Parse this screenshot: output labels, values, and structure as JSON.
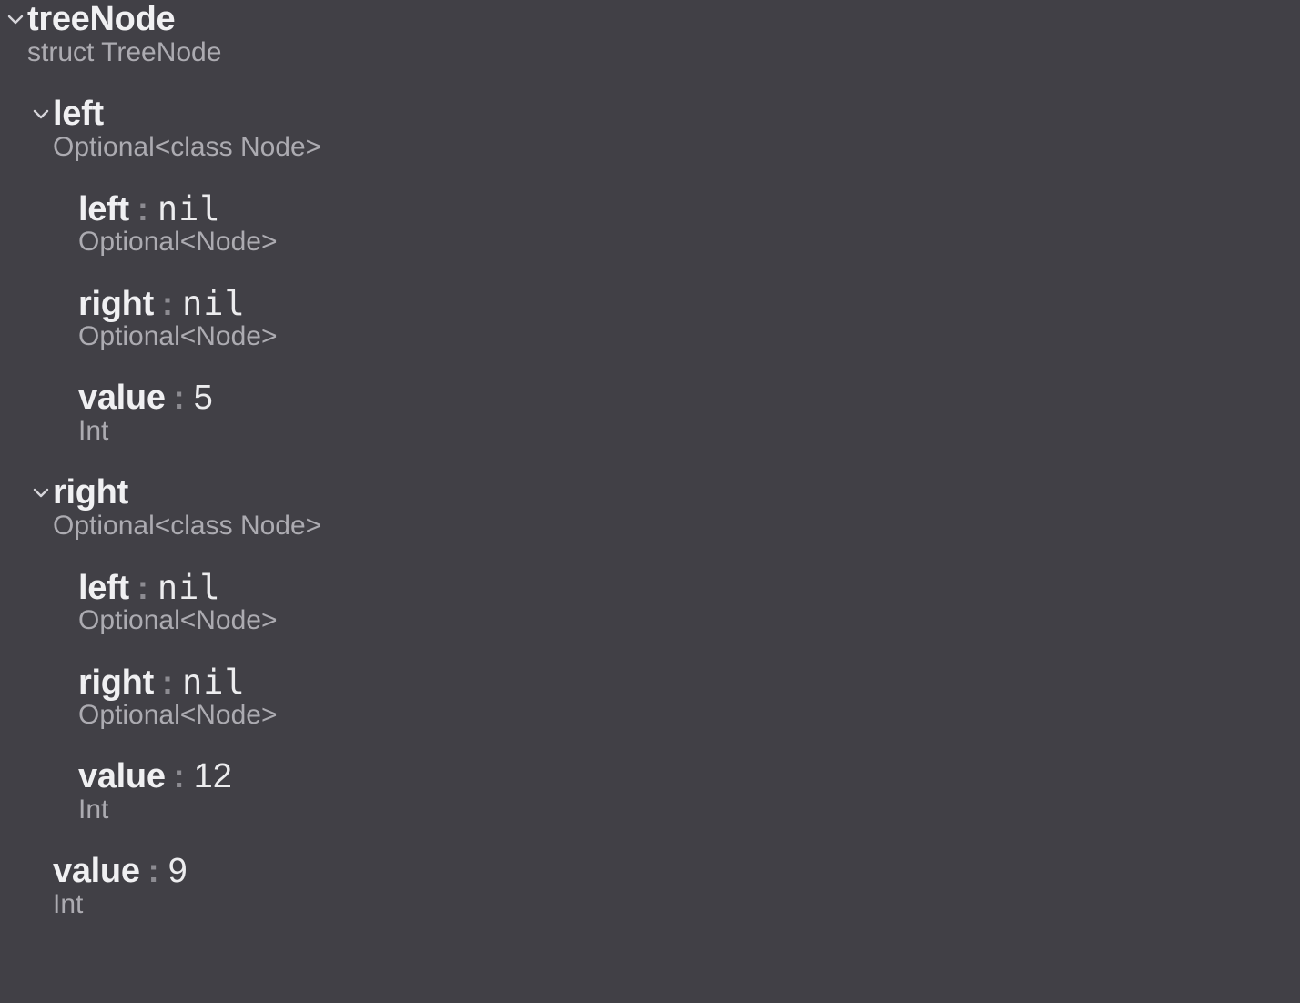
{
  "tree": {
    "root": {
      "name": "treeNode",
      "type": "struct TreeNode",
      "disclosure_icon": "chevron-down-icon"
    },
    "left": {
      "name": "left",
      "type": "Optional<class Node>",
      "disclosure_icon": "chevron-down-icon",
      "children": [
        {
          "name": "left",
          "value": "nil",
          "type": "Optional<Node>"
        },
        {
          "name": "right",
          "value": "nil",
          "type": "Optional<Node>"
        },
        {
          "name": "value",
          "value": "5",
          "type": "Int"
        }
      ]
    },
    "right": {
      "name": "right",
      "type": "Optional<class Node>",
      "disclosure_icon": "chevron-down-icon",
      "children": [
        {
          "name": "left",
          "value": "nil",
          "type": "Optional<Node>"
        },
        {
          "name": "right",
          "value": "nil",
          "type": "Optional<Node>"
        },
        {
          "name": "value",
          "value": "12",
          "type": "Int"
        }
      ]
    },
    "value": {
      "name": "value",
      "value": "9",
      "type": "Int"
    },
    "separator": ":"
  }
}
